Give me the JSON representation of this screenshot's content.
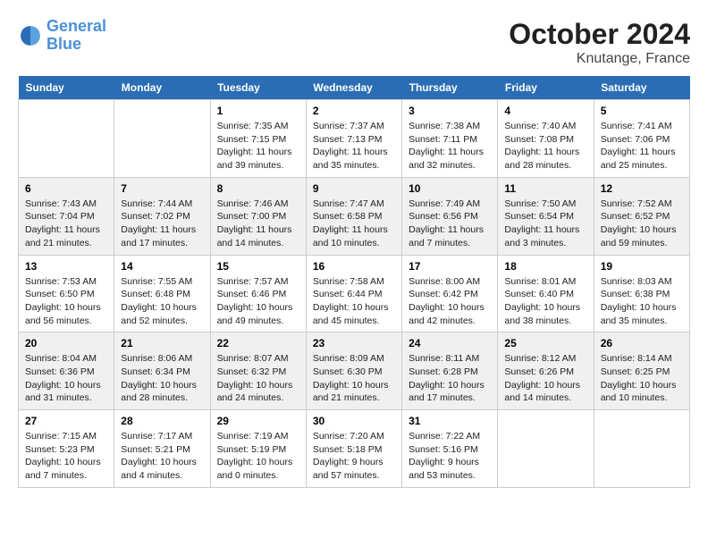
{
  "logo": {
    "text_general": "General",
    "text_blue": "Blue"
  },
  "title": "October 2024",
  "location": "Knutange, France",
  "days_of_week": [
    "Sunday",
    "Monday",
    "Tuesday",
    "Wednesday",
    "Thursday",
    "Friday",
    "Saturday"
  ],
  "weeks": [
    [
      {
        "day": "",
        "sunrise": "",
        "sunset": "",
        "daylight": ""
      },
      {
        "day": "",
        "sunrise": "",
        "sunset": "",
        "daylight": ""
      },
      {
        "day": "1",
        "sunrise": "Sunrise: 7:35 AM",
        "sunset": "Sunset: 7:15 PM",
        "daylight": "Daylight: 11 hours and 39 minutes."
      },
      {
        "day": "2",
        "sunrise": "Sunrise: 7:37 AM",
        "sunset": "Sunset: 7:13 PM",
        "daylight": "Daylight: 11 hours and 35 minutes."
      },
      {
        "day": "3",
        "sunrise": "Sunrise: 7:38 AM",
        "sunset": "Sunset: 7:11 PM",
        "daylight": "Daylight: 11 hours and 32 minutes."
      },
      {
        "day": "4",
        "sunrise": "Sunrise: 7:40 AM",
        "sunset": "Sunset: 7:08 PM",
        "daylight": "Daylight: 11 hours and 28 minutes."
      },
      {
        "day": "5",
        "sunrise": "Sunrise: 7:41 AM",
        "sunset": "Sunset: 7:06 PM",
        "daylight": "Daylight: 11 hours and 25 minutes."
      }
    ],
    [
      {
        "day": "6",
        "sunrise": "Sunrise: 7:43 AM",
        "sunset": "Sunset: 7:04 PM",
        "daylight": "Daylight: 11 hours and 21 minutes."
      },
      {
        "day": "7",
        "sunrise": "Sunrise: 7:44 AM",
        "sunset": "Sunset: 7:02 PM",
        "daylight": "Daylight: 11 hours and 17 minutes."
      },
      {
        "day": "8",
        "sunrise": "Sunrise: 7:46 AM",
        "sunset": "Sunset: 7:00 PM",
        "daylight": "Daylight: 11 hours and 14 minutes."
      },
      {
        "day": "9",
        "sunrise": "Sunrise: 7:47 AM",
        "sunset": "Sunset: 6:58 PM",
        "daylight": "Daylight: 11 hours and 10 minutes."
      },
      {
        "day": "10",
        "sunrise": "Sunrise: 7:49 AM",
        "sunset": "Sunset: 6:56 PM",
        "daylight": "Daylight: 11 hours and 7 minutes."
      },
      {
        "day": "11",
        "sunrise": "Sunrise: 7:50 AM",
        "sunset": "Sunset: 6:54 PM",
        "daylight": "Daylight: 11 hours and 3 minutes."
      },
      {
        "day": "12",
        "sunrise": "Sunrise: 7:52 AM",
        "sunset": "Sunset: 6:52 PM",
        "daylight": "Daylight: 10 hours and 59 minutes."
      }
    ],
    [
      {
        "day": "13",
        "sunrise": "Sunrise: 7:53 AM",
        "sunset": "Sunset: 6:50 PM",
        "daylight": "Daylight: 10 hours and 56 minutes."
      },
      {
        "day": "14",
        "sunrise": "Sunrise: 7:55 AM",
        "sunset": "Sunset: 6:48 PM",
        "daylight": "Daylight: 10 hours and 52 minutes."
      },
      {
        "day": "15",
        "sunrise": "Sunrise: 7:57 AM",
        "sunset": "Sunset: 6:46 PM",
        "daylight": "Daylight: 10 hours and 49 minutes."
      },
      {
        "day": "16",
        "sunrise": "Sunrise: 7:58 AM",
        "sunset": "Sunset: 6:44 PM",
        "daylight": "Daylight: 10 hours and 45 minutes."
      },
      {
        "day": "17",
        "sunrise": "Sunrise: 8:00 AM",
        "sunset": "Sunset: 6:42 PM",
        "daylight": "Daylight: 10 hours and 42 minutes."
      },
      {
        "day": "18",
        "sunrise": "Sunrise: 8:01 AM",
        "sunset": "Sunset: 6:40 PM",
        "daylight": "Daylight: 10 hours and 38 minutes."
      },
      {
        "day": "19",
        "sunrise": "Sunrise: 8:03 AM",
        "sunset": "Sunset: 6:38 PM",
        "daylight": "Daylight: 10 hours and 35 minutes."
      }
    ],
    [
      {
        "day": "20",
        "sunrise": "Sunrise: 8:04 AM",
        "sunset": "Sunset: 6:36 PM",
        "daylight": "Daylight: 10 hours and 31 minutes."
      },
      {
        "day": "21",
        "sunrise": "Sunrise: 8:06 AM",
        "sunset": "Sunset: 6:34 PM",
        "daylight": "Daylight: 10 hours and 28 minutes."
      },
      {
        "day": "22",
        "sunrise": "Sunrise: 8:07 AM",
        "sunset": "Sunset: 6:32 PM",
        "daylight": "Daylight: 10 hours and 24 minutes."
      },
      {
        "day": "23",
        "sunrise": "Sunrise: 8:09 AM",
        "sunset": "Sunset: 6:30 PM",
        "daylight": "Daylight: 10 hours and 21 minutes."
      },
      {
        "day": "24",
        "sunrise": "Sunrise: 8:11 AM",
        "sunset": "Sunset: 6:28 PM",
        "daylight": "Daylight: 10 hours and 17 minutes."
      },
      {
        "day": "25",
        "sunrise": "Sunrise: 8:12 AM",
        "sunset": "Sunset: 6:26 PM",
        "daylight": "Daylight: 10 hours and 14 minutes."
      },
      {
        "day": "26",
        "sunrise": "Sunrise: 8:14 AM",
        "sunset": "Sunset: 6:25 PM",
        "daylight": "Daylight: 10 hours and 10 minutes."
      }
    ],
    [
      {
        "day": "27",
        "sunrise": "Sunrise: 7:15 AM",
        "sunset": "Sunset: 5:23 PM",
        "daylight": "Daylight: 10 hours and 7 minutes."
      },
      {
        "day": "28",
        "sunrise": "Sunrise: 7:17 AM",
        "sunset": "Sunset: 5:21 PM",
        "daylight": "Daylight: 10 hours and 4 minutes."
      },
      {
        "day": "29",
        "sunrise": "Sunrise: 7:19 AM",
        "sunset": "Sunset: 5:19 PM",
        "daylight": "Daylight: 10 hours and 0 minutes."
      },
      {
        "day": "30",
        "sunrise": "Sunrise: 7:20 AM",
        "sunset": "Sunset: 5:18 PM",
        "daylight": "Daylight: 9 hours and 57 minutes."
      },
      {
        "day": "31",
        "sunrise": "Sunrise: 7:22 AM",
        "sunset": "Sunset: 5:16 PM",
        "daylight": "Daylight: 9 hours and 53 minutes."
      },
      {
        "day": "",
        "sunrise": "",
        "sunset": "",
        "daylight": ""
      },
      {
        "day": "",
        "sunrise": "",
        "sunset": "",
        "daylight": ""
      }
    ]
  ]
}
